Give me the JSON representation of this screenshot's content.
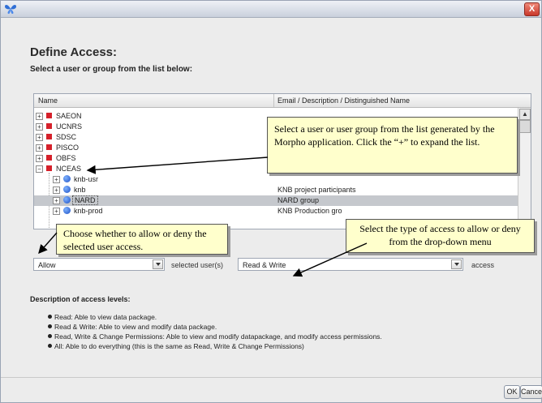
{
  "window": {
    "close_glyph": "X"
  },
  "heading": "Define Access:",
  "subheading": "Select a user or group from the list below:",
  "table": {
    "columns": [
      "Name",
      "Email / Description / Distinguished Name"
    ],
    "rows": [
      {
        "label": "SAEON",
        "desc": "",
        "icon": "red-square"
      },
      {
        "label": "UCNRS",
        "desc": "",
        "icon": "red-square"
      },
      {
        "label": "SDSC",
        "desc": "",
        "icon": "red-square"
      },
      {
        "label": "PISCO",
        "desc": "",
        "icon": "red-square"
      },
      {
        "label": "OBFS",
        "desc": "",
        "icon": "red-square"
      },
      {
        "label": "NCEAS",
        "desc": "",
        "icon": "red-square"
      },
      {
        "label": "knb-usr",
        "desc": "",
        "icon": "blue-globe"
      },
      {
        "label": "knb",
        "desc": "KNB project participants",
        "icon": "blue-globe"
      },
      {
        "label": "NARD",
        "desc": "NARD group",
        "icon": "blue-globe"
      },
      {
        "label": "knb-prod",
        "desc": "KNB Production gro",
        "icon": "blue-globe"
      }
    ],
    "selected_row": "NARD"
  },
  "callouts": {
    "list": "Select a user or user group from the list generated by the Morpho application. Click the “+” to expand the list.",
    "allow": "Choose whether to allow or deny the selected user access.",
    "access": "Select the type of access to allow or deny from the drop-down menu"
  },
  "controls": {
    "allow_value": "Allow",
    "selected_users_label": "selected user(s)",
    "access_value": "Read & Write",
    "access_label": "access"
  },
  "description": {
    "title": "Description of access levels:",
    "items": [
      "Read: Able to view data package.",
      "Read & Write: Able to view and modify data package.",
      "Read, Write & Change Permissions: Able to view and modify datapackage, and modify access permissions.",
      "All: Able to do everything (this is the same as Read, Write & Change Permissions)"
    ]
  },
  "buttons": {
    "ok": "OK",
    "cancel": "Cancel"
  },
  "colors": {
    "callout_bg": "#ffffcc",
    "selection": "#c5c8cd",
    "group_icon": "#d5202a",
    "user_icon": "#1d4fc4"
  }
}
